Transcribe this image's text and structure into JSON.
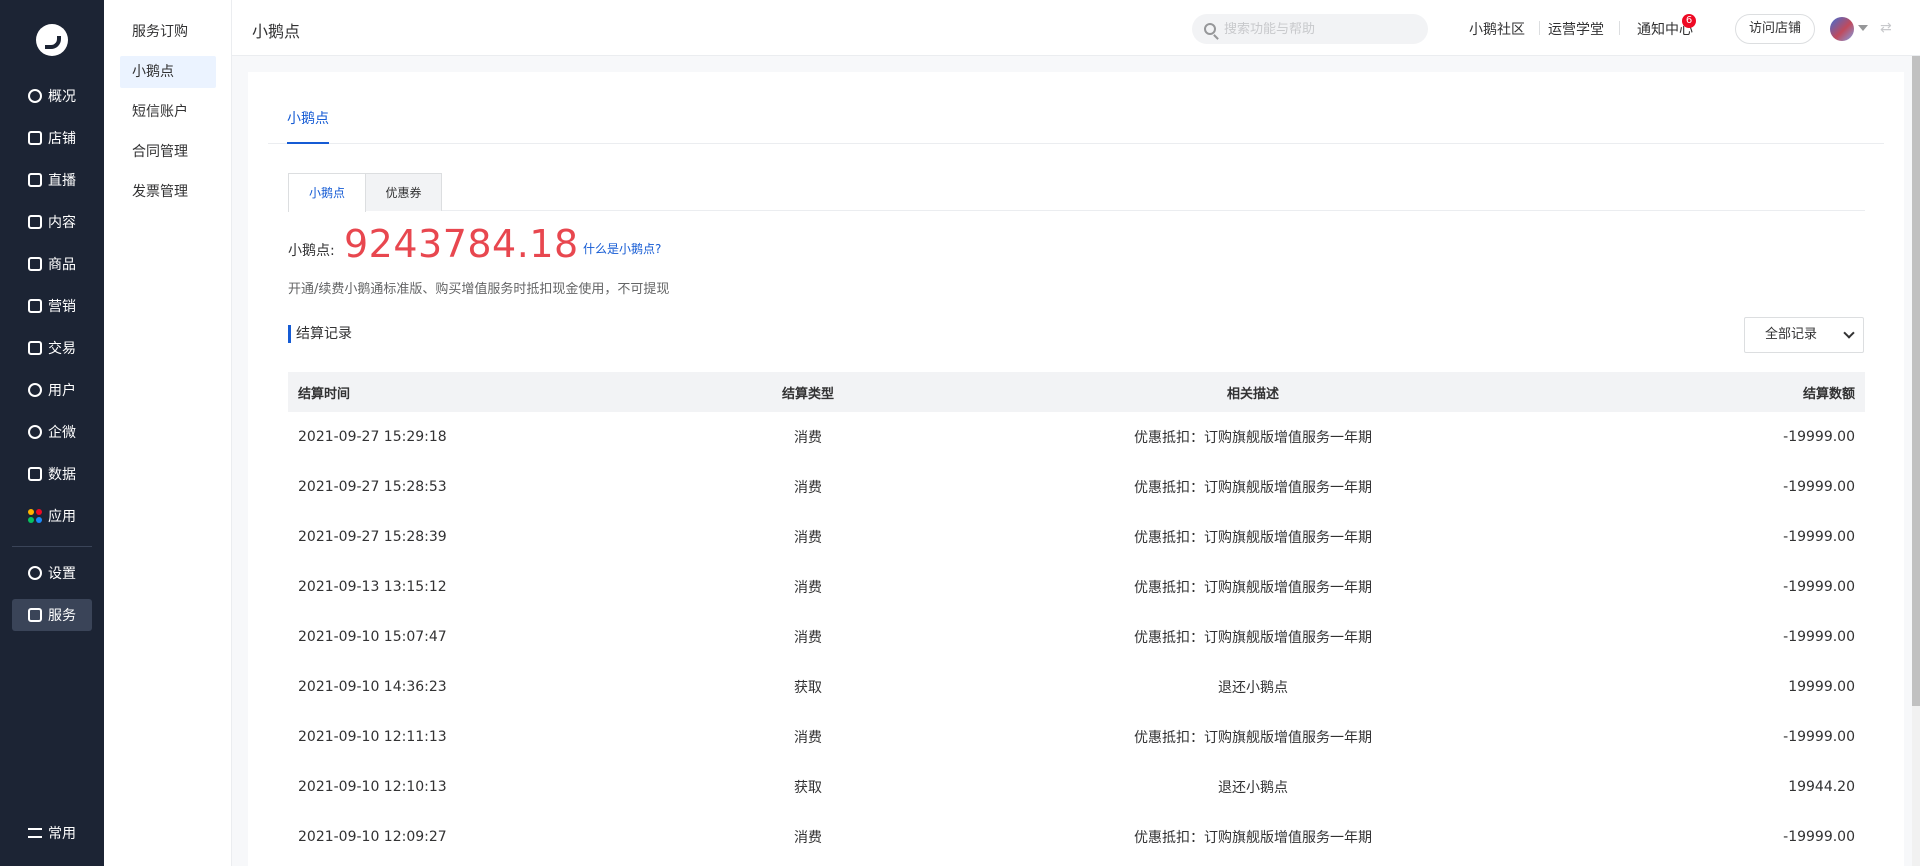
{
  "nav": {
    "items": [
      {
        "label": "概况",
        "icon": "chart-pie-icon"
      },
      {
        "label": "店铺",
        "icon": "store-icon"
      },
      {
        "label": "直播",
        "icon": "live-icon"
      },
      {
        "label": "内容",
        "icon": "document-icon"
      },
      {
        "label": "商品",
        "icon": "bag-icon"
      },
      {
        "label": "营销",
        "icon": "megaphone-icon"
      },
      {
        "label": "交易",
        "icon": "transaction-icon"
      },
      {
        "label": "用户",
        "icon": "user-icon"
      },
      {
        "label": "企微",
        "icon": "wecom-icon"
      },
      {
        "label": "数据",
        "icon": "data-icon"
      },
      {
        "label": "应用",
        "icon": "apps-icon"
      }
    ],
    "settings_label": "设置",
    "service_label": "服务",
    "common_label": "常用"
  },
  "subnav": {
    "items": [
      "服务订购",
      "小鹅点",
      "短信账户",
      "合同管理",
      "发票管理"
    ],
    "active": "小鹅点"
  },
  "header": {
    "title": "小鹅点",
    "search_placeholder": "搜索功能与帮助",
    "links": [
      "小鹅社区",
      "运营学堂",
      "通知中心"
    ],
    "notification_count": "6",
    "visit_store": "访问店铺"
  },
  "main": {
    "top_tab": "小鹅点",
    "seg_tabs": [
      "小鹅点",
      "优惠券"
    ],
    "balance_label": "小鹅点:",
    "balance_value": "9243784.18",
    "help_link": "什么是小鹅点?",
    "description": "开通/续费小鹅通标准版、购买增值服务时抵扣现金使用，不可提现",
    "section_title": "结算记录",
    "filter_value": "全部记录",
    "table": {
      "headers": [
        "结算时间",
        "结算类型",
        "相关描述",
        "结算数额"
      ],
      "rows": [
        [
          "2021-09-27 15:29:18",
          "消费",
          "优惠抵扣：订购旗舰版增值服务一年期",
          "-19999.00"
        ],
        [
          "2021-09-27 15:28:53",
          "消费",
          "优惠抵扣：订购旗舰版增值服务一年期",
          "-19999.00"
        ],
        [
          "2021-09-27 15:28:39",
          "消费",
          "优惠抵扣：订购旗舰版增值服务一年期",
          "-19999.00"
        ],
        [
          "2021-09-13 13:15:12",
          "消费",
          "优惠抵扣：订购旗舰版增值服务一年期",
          "-19999.00"
        ],
        [
          "2021-09-10 15:07:47",
          "消费",
          "优惠抵扣：订购旗舰版增值服务一年期",
          "-19999.00"
        ],
        [
          "2021-09-10 14:36:23",
          "获取",
          "退还小鹅点",
          "19999.00"
        ],
        [
          "2021-09-10 12:11:13",
          "消费",
          "优惠抵扣：订购旗舰版增值服务一年期",
          "-19999.00"
        ],
        [
          "2021-09-10 12:10:13",
          "获取",
          "退还小鹅点",
          "19944.20"
        ],
        [
          "2021-09-10 12:09:27",
          "消费",
          "优惠抵扣：订购旗舰版增值服务一年期",
          "-19999.00"
        ]
      ]
    }
  },
  "colors": {
    "nav_bg": "#1c2434",
    "accent": "#155bd4",
    "balance": "#e8474f"
  }
}
